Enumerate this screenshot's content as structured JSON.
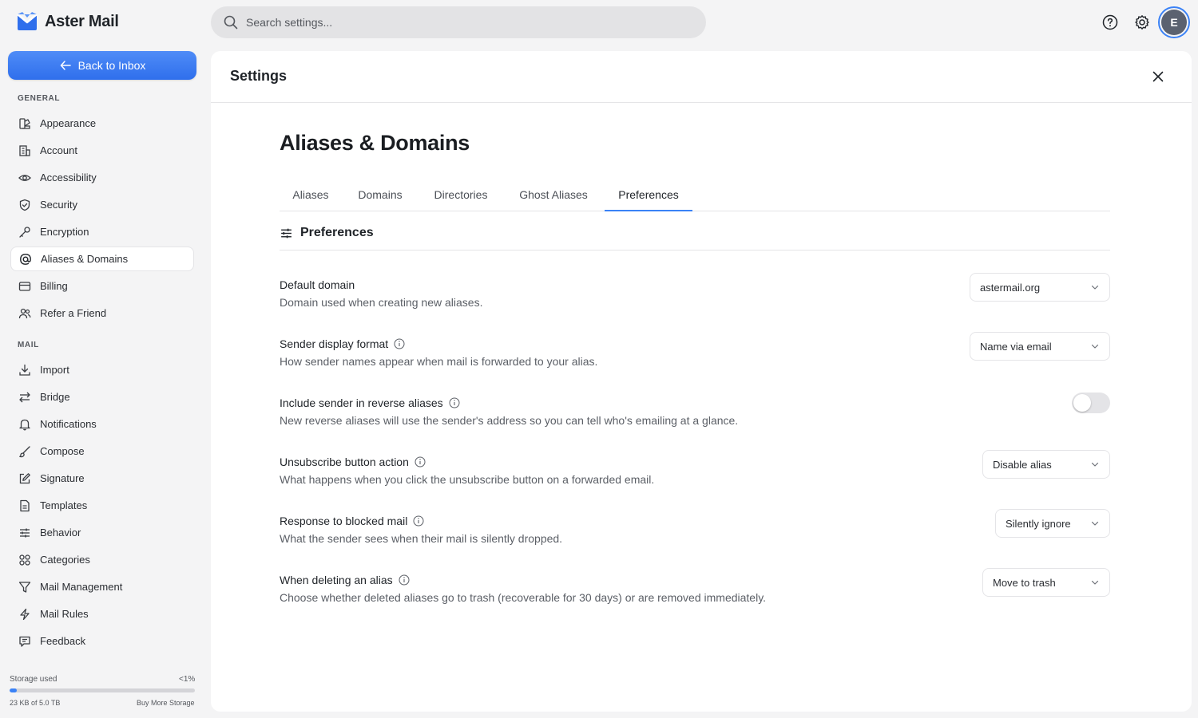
{
  "app": {
    "name": "Aster Mail",
    "brand_color": "#2f6fec"
  },
  "topbar": {
    "search_placeholder": "Search settings...",
    "help_icon": "question-circle-icon",
    "settings_icon": "gear-icon",
    "avatar_initial": "E"
  },
  "sidebar": {
    "back_label": "Back to Inbox",
    "general_label": "GENERAL",
    "general_items": [
      {
        "label": "Appearance",
        "icon": "palette-icon"
      },
      {
        "label": "Account",
        "icon": "building-icon"
      },
      {
        "label": "Accessibility",
        "icon": "eye-icon"
      },
      {
        "label": "Security",
        "icon": "shield-icon"
      },
      {
        "label": "Encryption",
        "icon": "key-icon"
      },
      {
        "label": "Aliases & Domains",
        "icon": "at-sign-icon",
        "active": true
      },
      {
        "label": "Billing",
        "icon": "credit-card-icon"
      },
      {
        "label": "Refer a Friend",
        "icon": "users-icon"
      }
    ],
    "mail_label": "MAIL",
    "mail_items": [
      {
        "label": "Import",
        "icon": "download-icon"
      },
      {
        "label": "Bridge",
        "icon": "arrows-exchange-icon"
      },
      {
        "label": "Notifications",
        "icon": "bell-icon"
      },
      {
        "label": "Compose",
        "icon": "brush-icon"
      },
      {
        "label": "Signature",
        "icon": "pen-square-icon"
      },
      {
        "label": "Templates",
        "icon": "document-icon"
      },
      {
        "label": "Behavior",
        "icon": "sliders-icon"
      },
      {
        "label": "Categories",
        "icon": "grid-icon"
      },
      {
        "label": "Mail Management",
        "icon": "filter-icon"
      },
      {
        "label": "Mail Rules",
        "icon": "bolt-icon"
      },
      {
        "label": "Feedback",
        "icon": "message-icon"
      }
    ],
    "storage": {
      "label": "Storage used",
      "percent_text": "<1%",
      "used_fraction": 0.01,
      "used_text": "23 KB of 5.0 TB",
      "buy_label": "Buy More Storage"
    }
  },
  "panel": {
    "title": "Settings",
    "page_title": "Aliases & Domains",
    "tabs": [
      "Aliases",
      "Domains",
      "Directories",
      "Ghost Aliases",
      "Preferences"
    ],
    "active_tab": "Preferences",
    "section_title": "Preferences",
    "settings": [
      {
        "title": "Default domain",
        "desc": "Domain used when creating new aliases.",
        "value": "astermail.org"
      },
      {
        "title": "Sender display format",
        "desc": "How sender names appear when mail is forwarded to your alias.",
        "value": "Name via email"
      },
      {
        "title": "Include sender in reverse aliases",
        "desc": "New reverse aliases will use the sender's address so you can tell who's emailing at a glance.",
        "toggle": false
      },
      {
        "title": "Unsubscribe button action",
        "desc": "What happens when you click the unsubscribe button on a forwarded email.",
        "value": "Disable alias"
      },
      {
        "title": "Response to blocked mail",
        "desc": "What the sender sees when their mail is silently dropped.",
        "value": "Silently ignore"
      },
      {
        "title": "When deleting an alias",
        "desc": "Choose whether deleted aliases go to trash (recoverable for 30 days) or are removed immediately.",
        "value": "Move to trash"
      }
    ]
  }
}
